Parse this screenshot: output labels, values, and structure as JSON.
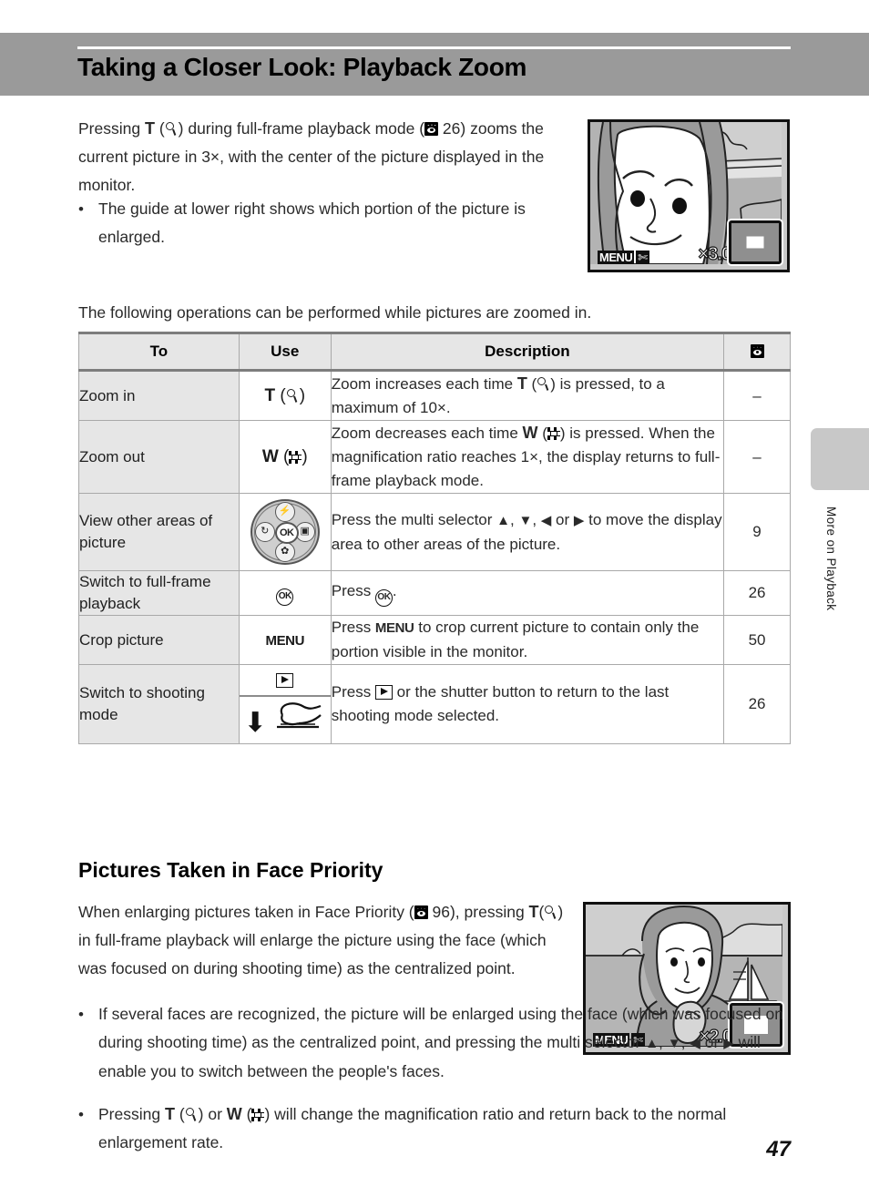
{
  "page": {
    "title": "Taking a Closer Look: Playback Zoom",
    "number": "47",
    "side_tab_label": "More on Playback"
  },
  "intro": {
    "para_part1": "Pressing ",
    "para_t": "T",
    "para_part2": ") during full-frame playback mode (",
    "para_ref": "26",
    "para_part3": ") zooms the current picture in 3×, with the center of the picture displayed in the monitor.",
    "bullet": "The guide at lower right shows which portion of the picture is enlarged.",
    "lead_in": "The following operations can be performed while pictures are zoomed in."
  },
  "lcd_top": {
    "menu_label": "MENU",
    "scissors_icon": "scissors-icon",
    "magnification": "×3.0",
    "guide_icon": "zoom-guide-icon"
  },
  "lcd_bottom": {
    "menu_label": "MENU",
    "scissors_icon": "scissors-icon",
    "magnification": "×2.0",
    "guide_icon": "zoom-guide-icon"
  },
  "table": {
    "headers": {
      "to": "To",
      "use": "Use",
      "description": "Description",
      "reference": "page-reference-icon"
    },
    "rows": [
      {
        "to": "Zoom in",
        "use_letter": "T",
        "use_icon": "magnify-icon",
        "desc_part1": "Zoom increases each time ",
        "desc_letter": "T",
        "desc_part2": ") is pressed, to a maximum of 10×.",
        "ref": "–"
      },
      {
        "to": "Zoom out",
        "use_letter": "W",
        "use_icon": "thumbnail-icon",
        "desc_part1": "Zoom decreases each time ",
        "desc_letter": "W",
        "desc_part2": ") is pressed. When the magnification ratio reaches 1×, the display returns to full-frame playback mode.",
        "ref": "–"
      },
      {
        "to": "View other areas of picture",
        "use_icon": "multi-selector-icon",
        "desc_part1": "Press the multi selector ",
        "desc_part2": " to move the display area to other areas of the picture.",
        "ref": "9"
      },
      {
        "to": "Switch to full-frame playback",
        "use_icon": "ok-button-icon",
        "desc_part1": "Press ",
        "desc_part2": ".",
        "ref": "26"
      },
      {
        "to": "Crop picture",
        "use_icon": "menu-button-icon",
        "use_label": "MENU",
        "desc_part1": "Press ",
        "desc_menu": "MENU",
        "desc_part2": " to crop current picture to contain only the portion visible in the monitor.",
        "ref": "50"
      },
      {
        "to": "Switch to shooting mode",
        "use_icon_top": "playback-button-icon",
        "use_icon_arrow": "down-arrow-icon",
        "use_icon_bottom": "shutter-button-icon",
        "desc_part1": "Press ",
        "desc_part2": " or the shutter button to return to the last shooting mode selected.",
        "ref": "26"
      }
    ]
  },
  "section2": {
    "title": "Pictures Taken in Face Priority",
    "para_part1": "When enlarging pictures taken in Face Priority (",
    "para_ref": "96",
    "para_part2": "), pressing ",
    "para_t": "T",
    "para_part3": ") in full-frame playback will enlarge the picture using the face (which was focused on during shooting time) as the centralized point.",
    "bullet1_part1": "If several faces are recognized, the picture will be enlarged using the face (which was focused on during shooting time) as the centralized point, and pressing the multi selector ",
    "bullet1_part2": " will enable you to switch between the people's faces.",
    "bullet2_part1": "Pressing ",
    "bullet2_t": "T",
    "bullet2_mid": ") or ",
    "bullet2_w": "W",
    "bullet2_part2": ") will change the magnification ratio and return back to the normal enlargement rate."
  },
  "colors": {
    "header_band": "#9a9a9a",
    "table_header_bg": "#e6e6e6",
    "table_label_bg": "#e6e6e6",
    "table_border": "#7d7d7d",
    "side_tab": "#c8c8c8"
  }
}
